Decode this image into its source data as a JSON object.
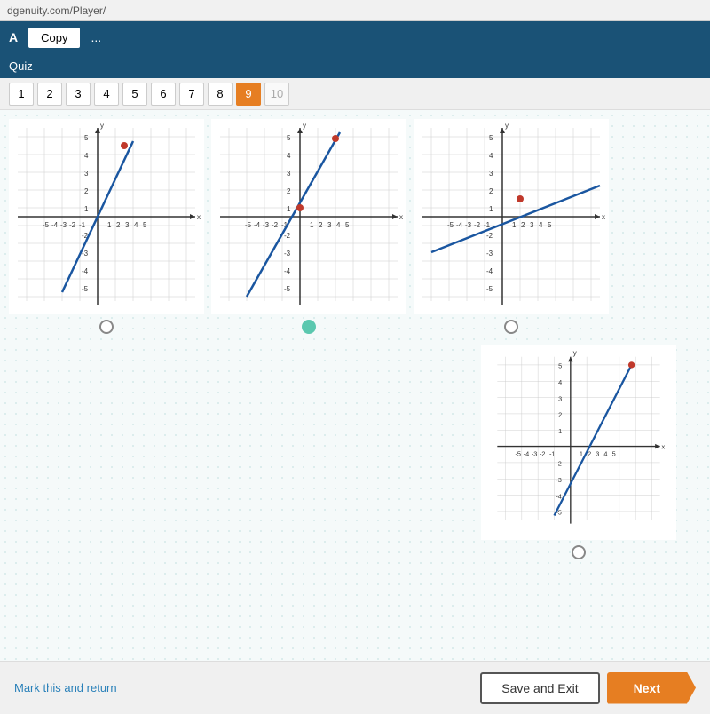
{
  "browser": {
    "url": "dgenuity.com/Player/"
  },
  "header": {
    "app_label": "A",
    "copy_label": "Copy",
    "more_label": "...",
    "quiz_label": "Quiz"
  },
  "page_numbers": {
    "items": [
      {
        "num": "1",
        "active": false
      },
      {
        "num": "2",
        "active": false
      },
      {
        "num": "3",
        "active": false
      },
      {
        "num": "4",
        "active": false
      },
      {
        "num": "5",
        "active": false
      },
      {
        "num": "6",
        "active": false
      },
      {
        "num": "7",
        "active": false
      },
      {
        "num": "8",
        "active": false
      },
      {
        "num": "9",
        "active": true
      },
      {
        "num": "10",
        "active": false
      }
    ]
  },
  "footer": {
    "mark_return_label": "Mark this and return",
    "save_exit_label": "Save and Exit",
    "next_label": "Next"
  }
}
